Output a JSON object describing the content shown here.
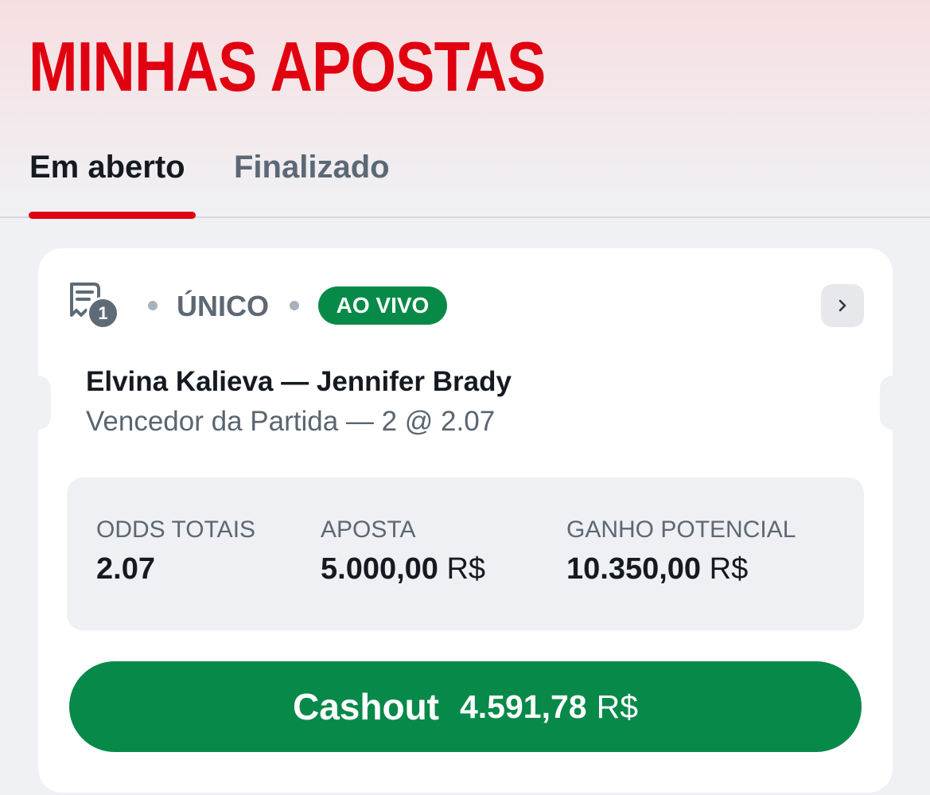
{
  "page": {
    "title": "MINHAS APOSTAS"
  },
  "tabs": [
    {
      "label": "Em aberto",
      "active": true
    },
    {
      "label": "Finalizado",
      "active": false
    }
  ],
  "colors": {
    "brand_red": "#e00010",
    "live_green": "#078a47",
    "cashout_green": "#07894a"
  },
  "bet": {
    "selection_count": "1",
    "type": "ÚNICO",
    "status_badge": "AO VIVO",
    "match": "Elvina Kalieva — Jennifer Brady",
    "market": "Vencedor da Partida — 2 @ 2.07",
    "icons": {
      "bet_slip": "receipt-icon",
      "details": "chevron-right-icon"
    },
    "summary": {
      "total_odds_label": "ODDS TOTAIS",
      "total_odds_value": "2.07",
      "stake_label": "APOSTA",
      "stake_value": "5.000,00",
      "stake_currency": "R$",
      "potential_win_label": "GANHO POTENCIAL",
      "potential_win_value": "10.350,00",
      "potential_win_currency": "R$"
    },
    "cashout": {
      "label": "Cashout",
      "amount": "4.591,78",
      "currency": "R$"
    }
  }
}
